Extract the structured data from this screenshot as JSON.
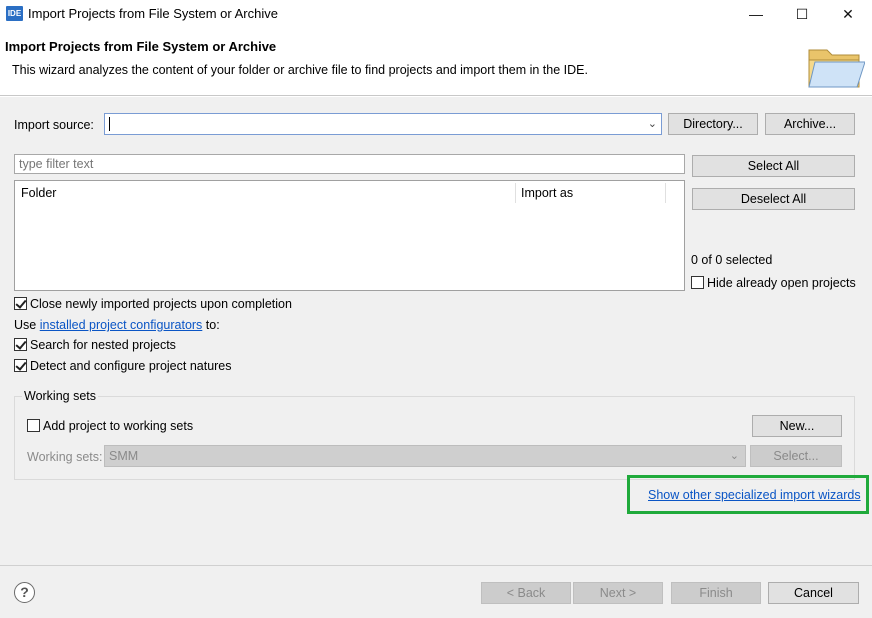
{
  "window": {
    "icon_text": "IDE",
    "title": "Import Projects from File System or Archive",
    "minimize": "—",
    "maximize": "☐",
    "close": "✕"
  },
  "header": {
    "title": "Import Projects from File System or Archive",
    "description": "This wizard analyzes the content of your folder or archive file to find projects and import them in the IDE.",
    "icon": "folder-icon"
  },
  "import_source": {
    "label": "Import source:",
    "value": "",
    "directory_button": "Directory...",
    "archive_button": "Archive..."
  },
  "filter": {
    "placeholder": "type filter text"
  },
  "table": {
    "columns": [
      "Folder",
      "Import as"
    ],
    "rows": []
  },
  "side_buttons": {
    "select_all": "Select All",
    "deselect_all": "Deselect All",
    "selection_status": "0 of 0 selected",
    "hide_open_projects": "Hide already open projects"
  },
  "options": {
    "close_imported": "Close newly imported projects upon completion",
    "use_prefix": "Use",
    "configurators_link": "installed project configurators",
    "use_suffix": "to:",
    "search_nested": "Search for nested projects",
    "detect_natures": "Detect and configure project natures"
  },
  "working_sets": {
    "legend": "Working sets",
    "add_to_sets": "Add project to working sets",
    "new_button": "New...",
    "sets_label": "Working sets:",
    "sets_value": "SMM",
    "select_button": "Select..."
  },
  "other_wizards_link": "Show other specialized import wizards",
  "footer": {
    "help": "?",
    "back": "< Back",
    "next": "Next >",
    "finish": "Finish",
    "cancel": "Cancel"
  },
  "colors": {
    "highlight": "#1faa3b",
    "link": "#0a55c5",
    "focus_border": "#7a9cd4"
  }
}
